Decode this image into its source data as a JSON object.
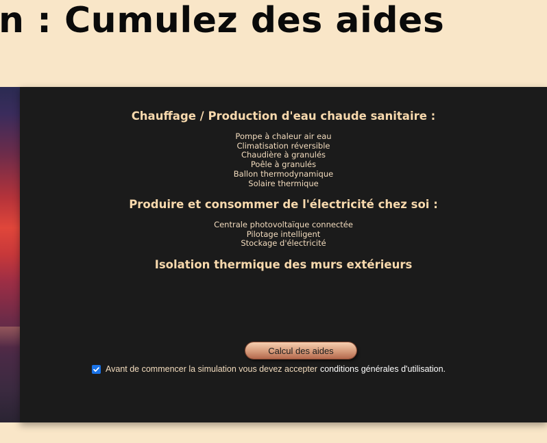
{
  "header": {
    "title": "n : Cumulez des aides"
  },
  "sections": [
    {
      "title": "Chauffage / Production d'eau chaude sanitaire :",
      "items": [
        "Pompe à chaleur air eau",
        "Climatisation réversible",
        "Chaudière à granulés",
        "Poêle à granulés",
        "Ballon thermodynamique",
        "Solaire thermique"
      ]
    },
    {
      "title": "Produire et consommer de l'électricité chez soi :",
      "items": [
        "Centrale photovoltaïque connectée",
        "Pilotage intelligent",
        "Stockage d'électricité"
      ]
    },
    {
      "title": "Isolation thermique des murs extérieurs",
      "items": []
    }
  ],
  "actions": {
    "calc_button_label": "Calcul des aides"
  },
  "consent": {
    "checked": true,
    "text": "Avant de commencer la simulation vous devez accepter",
    "link_text": "conditions générales d'utilisation."
  },
  "colors": {
    "page_background": "#f9e6c8",
    "panel_background": "#1b1b1b",
    "section_title": "#f8d9ad",
    "checkbox": "#1a73e8"
  },
  "icons": {
    "consent_checkbox": "checkmark-icon"
  }
}
